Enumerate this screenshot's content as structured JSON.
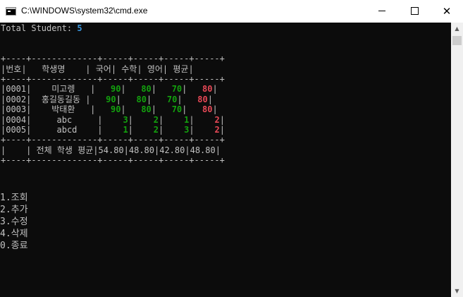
{
  "window": {
    "title": "C:\\WINDOWS\\system32\\cmd.exe"
  },
  "console": {
    "total_label": "Total Student: ",
    "total_value": "5",
    "header": {
      "no": "번호",
      "name": "학생명",
      "kor": "국어",
      "math": "수학",
      "eng": "영어",
      "avg": "평균"
    },
    "rows": [
      {
        "no": "0001",
        "name": "미고렝",
        "kor": "90",
        "math": "80",
        "eng": "70",
        "avg": "80"
      },
      {
        "no": "0002",
        "name": "홍길동길동",
        "kor": "90",
        "math": "80",
        "eng": "70",
        "avg": "80"
      },
      {
        "no": "0003",
        "name": "박태환",
        "kor": "90",
        "math": "80",
        "eng": "70",
        "avg": "80"
      },
      {
        "no": "0004",
        "name": "abc",
        "kor": "3",
        "math": "2",
        "eng": "1",
        "avg": "2"
      },
      {
        "no": "0005",
        "name": "abcd",
        "kor": "1",
        "math": "2",
        "eng": "3",
        "avg": "2"
      }
    ],
    "summary": {
      "label": "전체 학생 평균",
      "kor": "54.80",
      "math": "48.80",
      "eng": "42.80",
      "avg": "48.80"
    },
    "menu": [
      "1.조회",
      "2.추가",
      "3.수정",
      "4.삭제",
      "0.종료"
    ]
  },
  "colors": {
    "accent": "#3a96dd",
    "score": "#13a10e",
    "average": "#e74856",
    "background": "#0c0c0c",
    "text": "#c0c0c0"
  },
  "icons": {
    "app": "cmd-icon",
    "minimize": "minimize-icon",
    "maximize": "maximize-icon",
    "close": "close-icon"
  }
}
